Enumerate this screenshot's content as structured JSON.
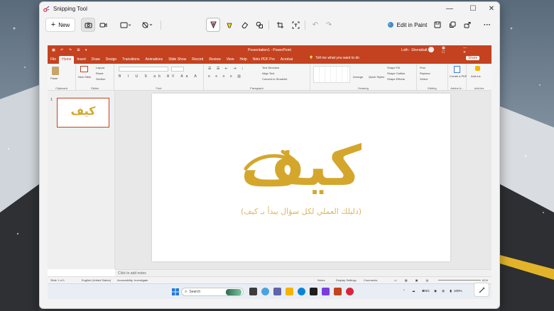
{
  "window": {
    "title": "Snipping Tool",
    "minimize": "—",
    "maximize": "☐",
    "close": "✕"
  },
  "toolbar": {
    "new_label": "New",
    "edit_in_paint": "Edit in Paint",
    "more": "···"
  },
  "powerpoint": {
    "file_title": "Presentation1 - PowerPoint",
    "user": "Loth · Sheraklatt",
    "tabs": [
      "File",
      "Home",
      "Insert",
      "Draw",
      "Design",
      "Transitions",
      "Animations",
      "Slide Show",
      "Record",
      "Review",
      "View",
      "Help",
      "Nitro PDF Pro",
      "Acrobat"
    ],
    "tell_me": "Tell me what you want to do",
    "share": "Share",
    "ribbon_groups": [
      "Clipboard",
      "Slides",
      "Font",
      "Paragraph",
      "Drawing",
      "Editing",
      "Adobe A...",
      "Add-ins"
    ],
    "ribbon_items": {
      "paste": "Paste",
      "new_slide": "New Slide",
      "layout": "Layout",
      "reset": "Reset",
      "section": "Section",
      "text_direction": "Text Direction",
      "align_text": "Align Text",
      "convert_smartart": "Convert to SmartArt",
      "arrange": "Arrange",
      "quick_styles": "Quick Styles",
      "shape_fill": "Shape Fill",
      "shape_outline": "Shape Outline",
      "shape_effects": "Shape Effects",
      "find": "Find",
      "replace": "Replace",
      "select": "Select",
      "create_pdf": "Create a PDF",
      "add_ins": "Add-ins"
    },
    "slide_number": "1",
    "slide_text_main": "كيف",
    "slide_text_sub": "(دليلك العملي لكل سؤال يبدأ بـ كيف)",
    "notes_placeholder": "Click to add notes",
    "status": {
      "slide": "Slide 1 of 1",
      "language": "English (United States)",
      "accessibility": "Accessibility: Investigate",
      "notes": "Notes",
      "display": "Display Settings",
      "comments": "Comments",
      "zoom": "81%"
    }
  },
  "taskbar": {
    "search": "Search",
    "lang": "ENG",
    "battery": "100%"
  },
  "colors": {
    "accent": "#c4421f",
    "gold": "#d4a72c",
    "snip_red": "#d8253b"
  }
}
